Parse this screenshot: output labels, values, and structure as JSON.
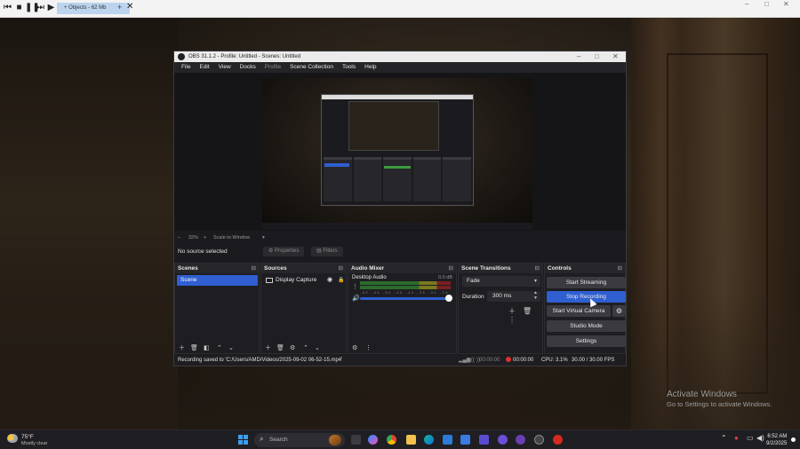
{
  "top_toolbar": {
    "tab_label": "+ Objects - 62 Mb",
    "add_label": "+",
    "close_label": "✕"
  },
  "obs": {
    "title": "OBS 31.1.2 - Profile: Untitled - Scenes: Untitled",
    "menu": [
      "File",
      "Edit",
      "View",
      "Docks",
      "Profile",
      "Scene Collection",
      "Tools",
      "Help"
    ],
    "zoom": {
      "percent": "32%",
      "scale_mode": "Scale to Window"
    },
    "no_source": "No source selected",
    "properties_label": "Properties",
    "filters_label": "Filters",
    "scenes": {
      "title": "Scenes",
      "items": [
        "Scene"
      ]
    },
    "sources": {
      "title": "Sources",
      "items": [
        "Display Capture"
      ]
    },
    "audio_mixer": {
      "title": "Audio Mixer",
      "channel": "Desktop Audio",
      "db": "0.0 dB",
      "scale": "-60 -55 -50 -45 -40 -35 -30 -25 -20 -15 -10 -5 0"
    },
    "transitions": {
      "title": "Scene Transitions",
      "selected": "Fade",
      "duration_label": "Duration",
      "duration_value": "300 ms"
    },
    "controls": {
      "title": "Controls",
      "start_streaming": "Start Streaming",
      "stop_recording": "Stop Recording",
      "start_virtual_camera": "Start Virtual Camera",
      "studio_mode": "Studio Mode",
      "settings": "Settings"
    },
    "status": {
      "message": "Recording saved to 'C:/Users/AMD/Videos/2025-09-02 06-52-15.mp4'",
      "stream_time": "00:00:00",
      "rec_time": "00:00:00",
      "cpu": "CPU: 3.1%",
      "fps": "30.00 / 30.00 FPS"
    }
  },
  "watermark": {
    "line1": "Activate Windows",
    "line2": "Go to Settings to activate Windows."
  },
  "taskbar": {
    "temperature": "75°F",
    "weather": "Mostly clear",
    "search_label": "Search",
    "time": "6:52 AM",
    "date": "9/2/2025"
  },
  "colors": {
    "accent_blue": "#2f5fd0",
    "recording_red": "#e03030",
    "obs_dark": "#1b1b1f"
  }
}
